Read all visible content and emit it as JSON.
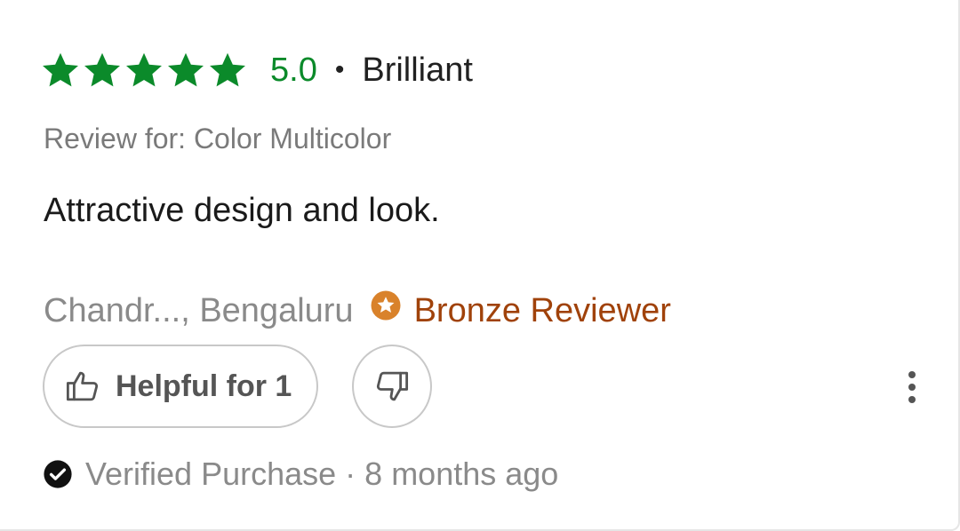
{
  "review": {
    "rating_value": "5.0",
    "stars_filled": 5,
    "stars_total": 5,
    "separator": "•",
    "rating_text": "Brilliant",
    "review_for": "Review for: Color Multicolor",
    "body": "Attractive design and look.",
    "reviewer": "Chandr..., Bengaluru",
    "badge": "Bronze Reviewer",
    "helpful_label": "Helpful for 1",
    "verified": "Verified Purchase",
    "meta_separator": "·",
    "time_ago": "8 months ago"
  },
  "icons": {
    "star": "star-icon",
    "badge": "bronze-star-badge-icon",
    "like": "thumbs-up-icon",
    "dislike": "thumbs-down-icon",
    "more": "more-vertical-icon",
    "verified": "check-circle-icon"
  },
  "colors": {
    "star": "#0b8a2a",
    "rating_value": "#0b8a2a",
    "badge_text": "#a0420a",
    "badge_icon": "#d9822b",
    "muted_text": "#8a8a8a"
  }
}
